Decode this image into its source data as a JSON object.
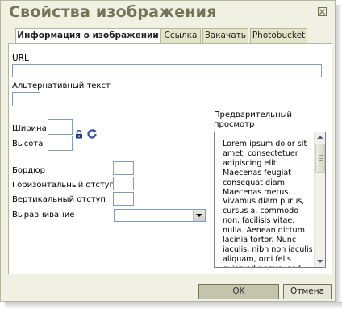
{
  "dialog": {
    "title": "Свойства изображения"
  },
  "tabs": [
    {
      "label": "Информация о изображении"
    },
    {
      "label": "Ссылка"
    },
    {
      "label": "Закачать"
    },
    {
      "label": "Photobucket"
    }
  ],
  "form": {
    "url_label": "URL",
    "url_value": "",
    "alt_label": "Альтернативный текст",
    "alt_value": "",
    "width_label": "Ширина",
    "width_value": "",
    "height_label": "Высота",
    "height_value": "",
    "border_label": "Бордюр",
    "border_value": "",
    "hspace_label": "Горизонтальный отступ",
    "hspace_value": "",
    "vspace_label": "Вертикальный отступ",
    "vspace_value": "",
    "align_label": "Выравнивание",
    "align_value": ""
  },
  "preview": {
    "label_line1": "Предварительный",
    "label_line2": "просмотр",
    "text": "Lorem ipsum dolor sit amet, consectetuer adipiscing elit. Maecenas feugiat consequat diam. Maecenas metus. Vivamus diam purus, cursus a, commodo non, facilisis vitae, nulla. Aenean dictum lacinia tortor. Nunc iaculis, nibh non iaculis aliquam, orci felis euismod neque, sed ornare massa mauris sed velit."
  },
  "buttons": {
    "ok": "OK",
    "cancel": "Отмена"
  },
  "icons": {
    "close": "close-icon",
    "lock": "lock-icon",
    "reset": "refresh-icon"
  },
  "colors": {
    "title": "#737357",
    "dialog_bg": "#f1f1e3",
    "tab_bg": "#e3e3c7",
    "input_border": "#7f9db9",
    "lock": "#1f3c8f",
    "refresh": "#2f4fa8"
  }
}
